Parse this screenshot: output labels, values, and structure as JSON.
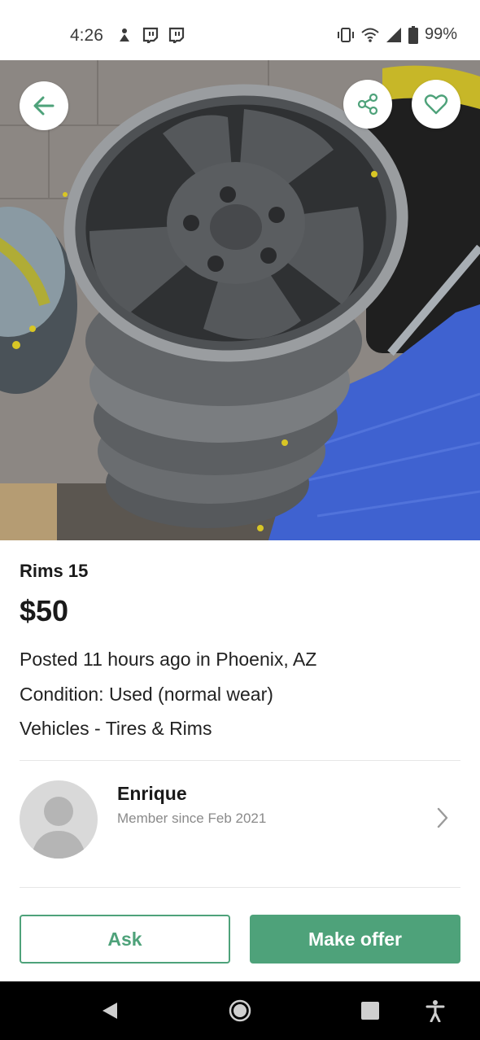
{
  "status_bar": {
    "time": "4:26",
    "battery": "99%",
    "icons": [
      "notification-icon",
      "twitch-icon",
      "twitch-icon",
      "vibrate-icon",
      "wifi-icon",
      "signal-icon",
      "battery-icon"
    ]
  },
  "listing": {
    "title": "Rims 15",
    "price": "$50",
    "posted": "Posted 11 hours ago in Phoenix, AZ",
    "condition": "Condition: Used (normal wear)",
    "category": "Vehicles - Tires & Rims"
  },
  "seller": {
    "name": "Enrique",
    "member_since": "Member since Feb 2021"
  },
  "actions": {
    "ask_label": "Ask",
    "offer_label": "Make offer"
  },
  "colors": {
    "accent": "#4ea27a",
    "navbar": "#000000"
  }
}
